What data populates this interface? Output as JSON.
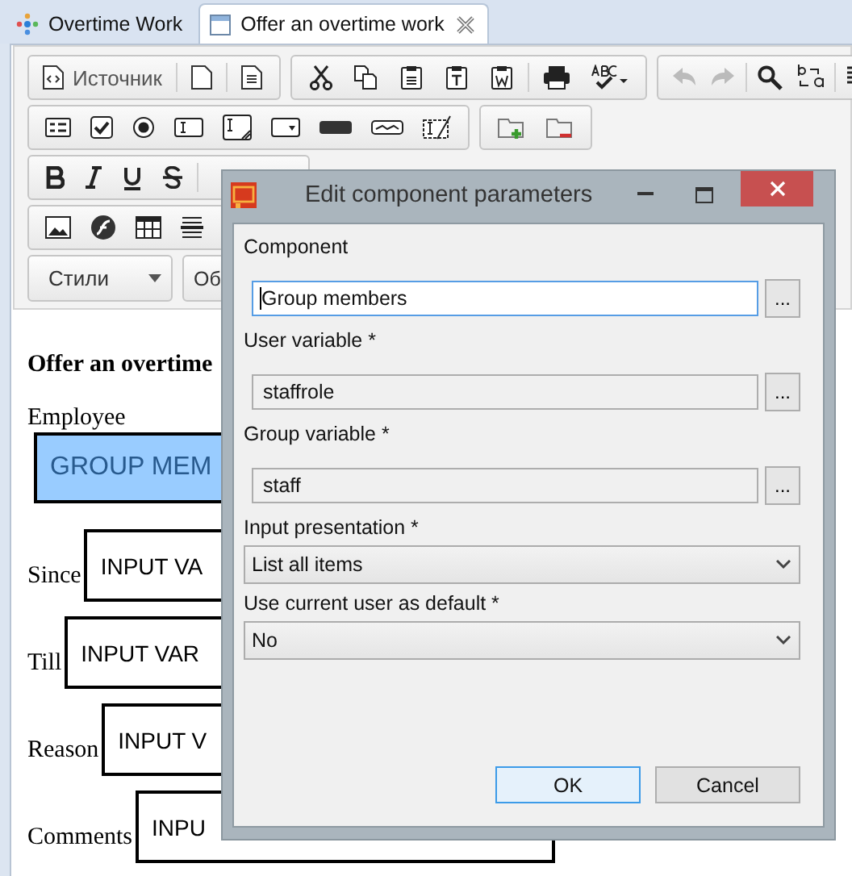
{
  "tabs": [
    {
      "label": "Overtime Work",
      "selected": false,
      "closable": false
    },
    {
      "label": "Offer an overtime work",
      "selected": true,
      "closable": true
    }
  ],
  "toolbar": {
    "source_label": "Источник",
    "styles_label": "Стили",
    "format_label": "Об"
  },
  "document": {
    "heading": "Offer an overtime",
    "fields": [
      {
        "kind": "group",
        "label": "Employee",
        "component": "GROUP MEM",
        "selected": true
      },
      {
        "kind": "input",
        "label": "Since",
        "component": "INPUT VA",
        "selected": false
      },
      {
        "kind": "input",
        "label": "Till",
        "component": "INPUT VAR",
        "selected": false
      },
      {
        "kind": "input",
        "label": "Reason",
        "component": "INPUT V",
        "selected": false
      },
      {
        "kind": "input",
        "label": "Comments",
        "component": "INPU",
        "selected": false
      }
    ]
  },
  "dialog": {
    "title": "Edit component parameters",
    "fields": [
      {
        "kind": "text",
        "label": "Component",
        "value": "Group members",
        "focused": true,
        "button": "..."
      },
      {
        "kind": "text",
        "label": "User variable *",
        "value": "staffrole",
        "focused": false,
        "button": "..."
      },
      {
        "kind": "text",
        "label": "Group variable *",
        "value": "staff",
        "focused": false,
        "button": "..."
      },
      {
        "kind": "select",
        "label": "Input presentation *",
        "value": "List all items"
      },
      {
        "kind": "select",
        "label": "Use current user as default *",
        "value": "No"
      }
    ],
    "buttons": [
      {
        "label": "OK",
        "default": true
      },
      {
        "label": "Cancel",
        "default": false
      }
    ]
  }
}
